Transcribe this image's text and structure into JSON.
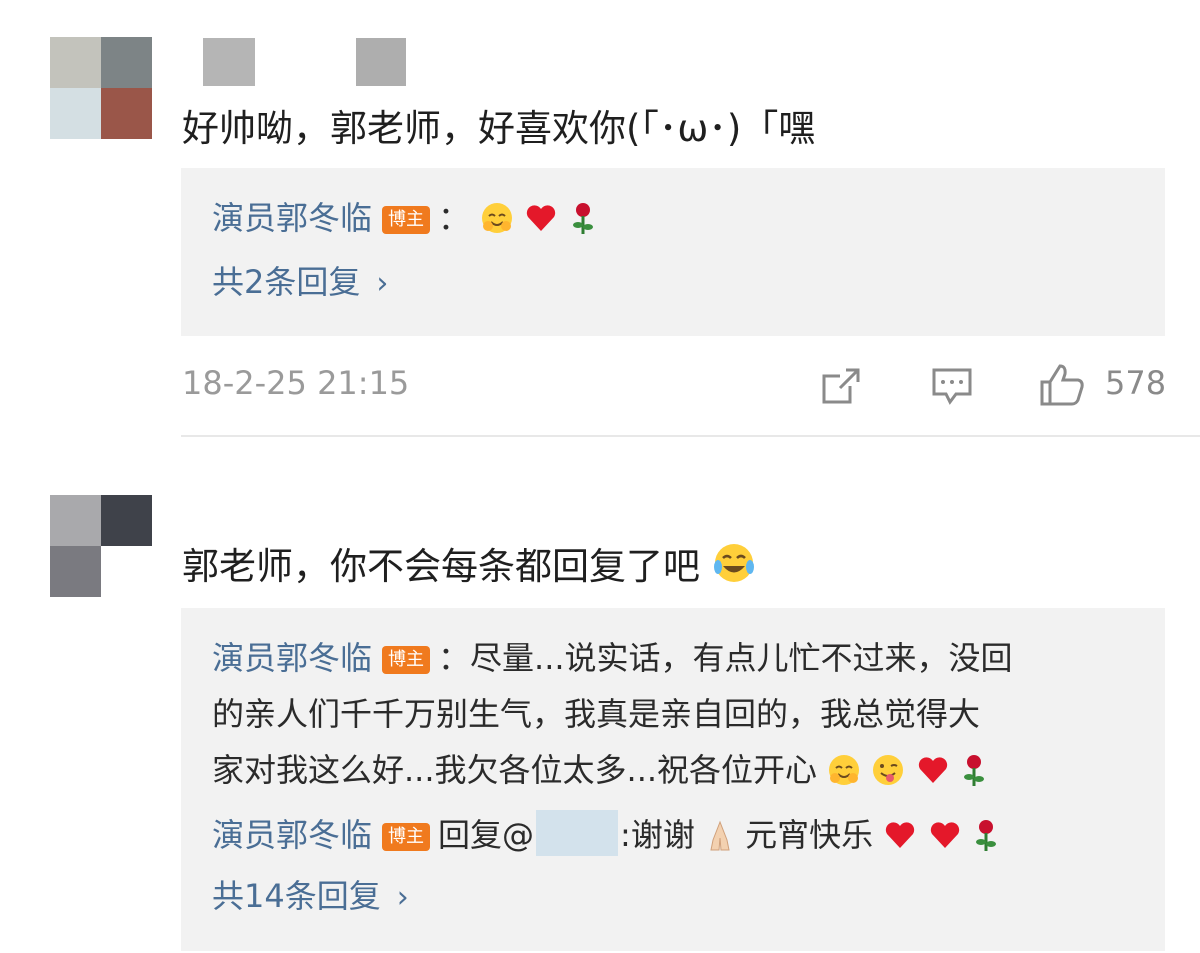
{
  "comments": [
    {
      "text": "好帅呦，郭老师，好喜欢你(「･ω･)「嘿",
      "reply": {
        "author": "演员郭冬临",
        "badge": "博主",
        "text": "："
      },
      "more_replies": "共2条回复",
      "time": "18-2-25 21:15",
      "likes": "578"
    },
    {
      "text": "郭老师，你不会每条都回复了吧",
      "reply": {
        "author": "演员郭冬临",
        "badge": "博主",
        "lines": [
          "：尽量...说实话，有点儿忙不过来，没回",
          "的亲人们千千万别生气，我真是亲自回的，我总觉得大",
          "家对我这么好...我欠各位太多...祝各位开心"
        ]
      },
      "second_reply": {
        "author": "演员郭冬临",
        "badge": "博主",
        "prefix": "回复@",
        "handle_suffix": "",
        "text": ":谢谢",
        "tail": "元宵快乐"
      },
      "more_replies": "共14条回复"
    }
  ],
  "icons": {
    "share": "share-icon",
    "comment": "comment-icon",
    "like": "like-icon",
    "chevron": "chevron-right-icon"
  },
  "colors": {
    "link": "#4a6e95",
    "badge": "#f07a1e",
    "reply_bg": "#f2f2f2",
    "meta": "#9a9a9a"
  }
}
